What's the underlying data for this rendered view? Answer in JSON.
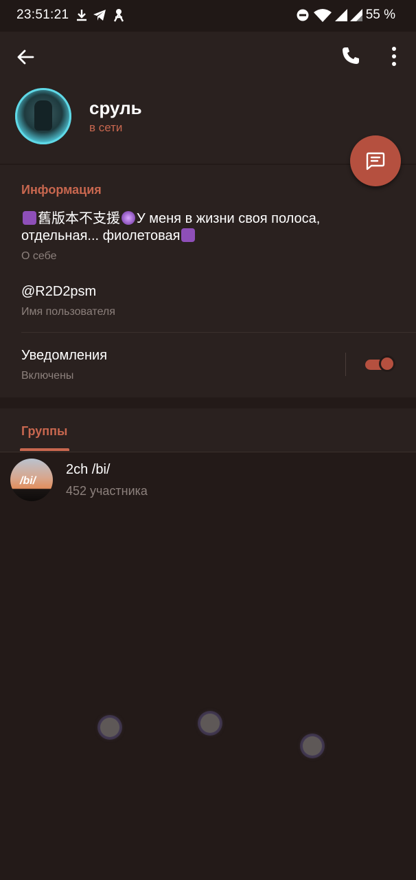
{
  "status_bar": {
    "time": "23:51:21",
    "battery": "55 %",
    "icons": [
      "download-icon",
      "telegram-icon",
      "app-icon",
      "dnd-icon",
      "wifi-icon",
      "signal-icon",
      "signal-icon"
    ]
  },
  "header": {
    "name": "сруль",
    "status": "в сети",
    "icons": [
      "back-arrow-icon",
      "phone-icon",
      "more-vert-icon",
      "message-icon"
    ]
  },
  "info": {
    "section_title": "Информация",
    "bio_line1": "舊版本不支援",
    "bio_line1b": "У меня в жизни своя полоса,",
    "bio_line2": "отдельная... фиолетовая",
    "bio_label": "О себе",
    "username": "@R2D2psm",
    "username_label": "Имя пользователя",
    "notifications": "Уведомления",
    "notifications_state": "Включены"
  },
  "groups": {
    "tab_label": "Группы",
    "items": [
      {
        "name": "2ch /bi/",
        "members": "452 участника",
        "avatar_text": "/bi/"
      }
    ]
  },
  "colors": {
    "accent": "#c8674f",
    "fab": "#b5503f",
    "background": "#231a18",
    "surface": "#2a211f"
  }
}
